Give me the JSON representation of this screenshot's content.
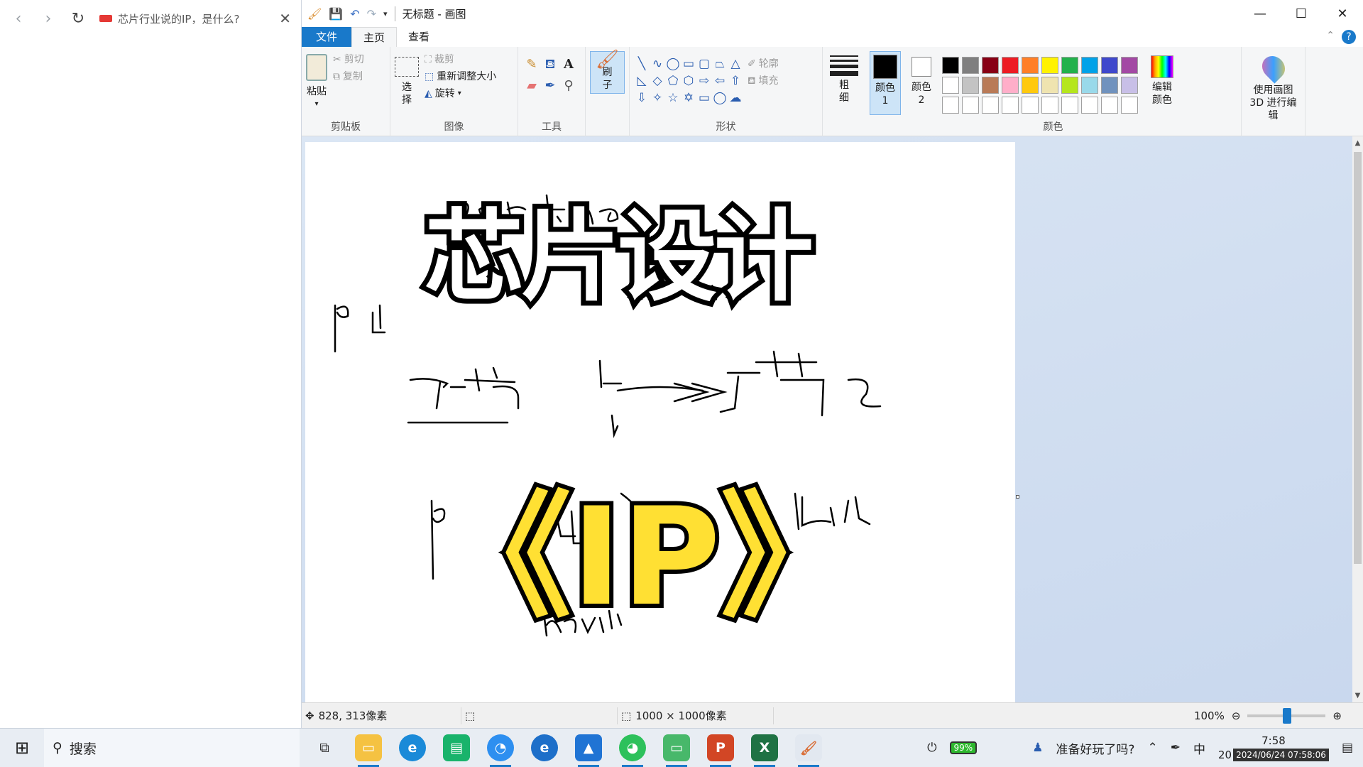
{
  "browser": {
    "tab_title": "芯片行业说的IP，是什么?"
  },
  "paint": {
    "window_title": "无标题 - 画图",
    "menu": {
      "file": "文件",
      "home": "主页",
      "view": "查看"
    },
    "clipboard": {
      "paste": "粘贴",
      "cut": "剪切",
      "copy": "复制",
      "label": "剪贴板"
    },
    "image": {
      "select": "选择",
      "crop": "裁剪",
      "resize": "重新调整大小",
      "rotate": "旋转",
      "label": "图像"
    },
    "tools": {
      "label": "工具",
      "brush": "刷子"
    },
    "shapes": {
      "outline": "轮廓",
      "fill": "填充",
      "label": "形状"
    },
    "size": {
      "label": "粗细"
    },
    "colors": {
      "color1": "颜色 1",
      "color2": "颜色 2",
      "edit": "编辑颜色",
      "paint3d": "使用画图 3D 进行编辑",
      "label": "颜色",
      "color1_value": "#000000",
      "color2_value": "#ffffff",
      "palette": [
        "#000000",
        "#7f7f7f",
        "#880015",
        "#ed1c24",
        "#ff7f27",
        "#fff200",
        "#22b14c",
        "#00a2e8",
        "#3f48cc",
        "#a349a4",
        "#ffffff",
        "#c3c3c3",
        "#b97a57",
        "#ffaec9",
        "#ffc90e",
        "#efe4b0",
        "#b5e61d",
        "#99d9ea",
        "#7092be",
        "#c8bfe7",
        "#ffffff",
        "#ffffff",
        "#ffffff",
        "#ffffff",
        "#ffffff",
        "#ffffff",
        "#ffffff",
        "#ffffff",
        "#ffffff",
        "#ffffff"
      ]
    },
    "canvas_art": {
      "title_text": "芯片设计",
      "ip_text": "《IP》",
      "ip_fill": "#ffe033"
    },
    "status": {
      "cursor_pos": "828, 313像素",
      "canvas_size": "1000 × 1000像素",
      "zoom": "100%"
    }
  },
  "taskbar": {
    "search": "搜索",
    "battery": "99%",
    "notification": "准备好玩了吗?",
    "ime": "中",
    "time": "7:58",
    "timestamp": "2024/06/24 07:58:06",
    "date_fragment": "20"
  }
}
